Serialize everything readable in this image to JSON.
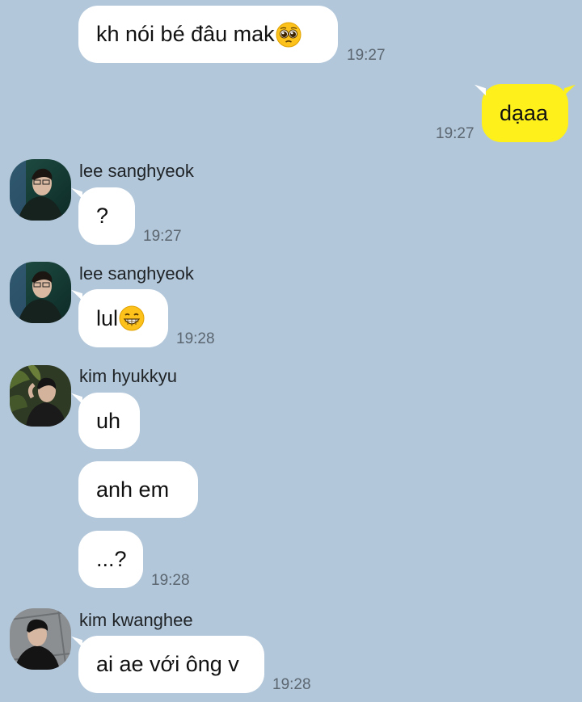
{
  "chat": {
    "colors": {
      "background": "#b2c7da",
      "incoming_bubble": "#ffffff",
      "outgoing_bubble": "#fef01b",
      "time_text": "#5b6670"
    },
    "messages": [
      {
        "text": "kh nói bé đâu mak",
        "emoji": "pleading-face-emoji",
        "time": "19:27",
        "direction": "incoming"
      },
      {
        "text": "dạaa",
        "time": "19:27",
        "direction": "outgoing"
      },
      {
        "sender": "lee sanghyeok",
        "text": "?",
        "time": "19:27",
        "direction": "incoming"
      },
      {
        "sender": "lee sanghyeok",
        "text": "lul",
        "emoji": "grinning-face-emoji",
        "time": "19:28",
        "direction": "incoming"
      },
      {
        "sender": "kim hyukkyu",
        "text": "uh",
        "direction": "incoming"
      },
      {
        "text": "anh em",
        "direction": "incoming"
      },
      {
        "text": "...?",
        "time": "19:28",
        "direction": "incoming"
      },
      {
        "sender": "kim kwanghee",
        "text": "ai ae với ông v",
        "time": "19:28",
        "direction": "incoming"
      }
    ]
  }
}
